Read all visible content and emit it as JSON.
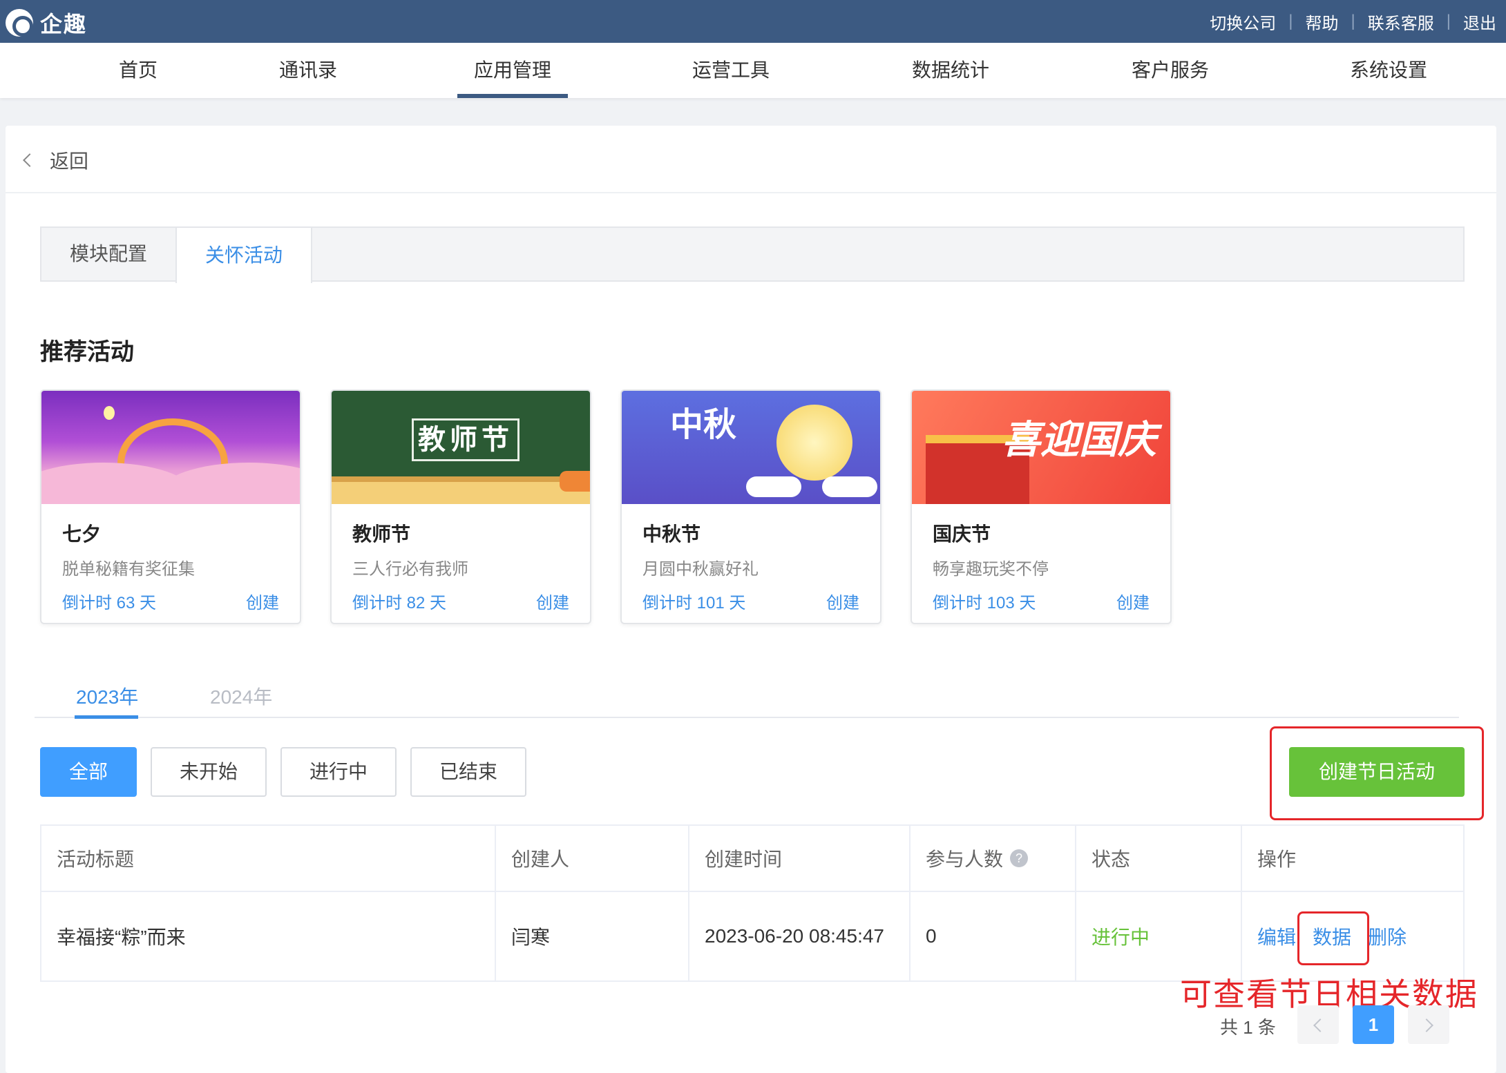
{
  "topbar": {
    "brand": "企趣",
    "links": [
      "切换公司",
      "帮助",
      "联系客服",
      "退出"
    ],
    "separator": "|"
  },
  "nav": {
    "items": [
      "首页",
      "通讯录",
      "应用管理",
      "运营工具",
      "数据统计",
      "客户服务",
      "系统设置"
    ],
    "active": "应用管理"
  },
  "back": {
    "label": "返回"
  },
  "tabs": [
    "模块配置",
    "关怀活动"
  ],
  "section_title": "推荐活动",
  "cards": [
    {
      "name": "七夕",
      "sub": "脱单秘籍有奖征集",
      "countdown": "倒计时 63 天",
      "action": "创建"
    },
    {
      "name": "教师节",
      "sub": "三人行必有我师",
      "countdown": "倒计时 82 天",
      "action": "创建",
      "banner_text": "教师节"
    },
    {
      "name": "中秋节",
      "sub": "月圆中秋赢好礼",
      "countdown": "倒计时 101 天",
      "action": "创建",
      "banner_text": "中秋"
    },
    {
      "name": "国庆节",
      "sub": "畅享趣玩奖不停",
      "countdown": "倒计时 103 天",
      "action": "创建",
      "banner_text": "喜迎国庆"
    }
  ],
  "years": [
    "2023年",
    "2024年"
  ],
  "filters": [
    "全部",
    "未开始",
    "进行中",
    "已结束"
  ],
  "create_button": "创建节日活动",
  "table": {
    "headers": [
      "活动标题",
      "创建人",
      "创建时间",
      "参与人数",
      "状态",
      "操作"
    ],
    "help_glyph": "?",
    "rows": [
      {
        "title": "幸福接“粽”而来",
        "creator": "闫寒",
        "created": "2023-06-20 08:45:47",
        "participants": "0",
        "status": "进行中",
        "ops": [
          "编辑",
          "数据",
          "删除"
        ]
      }
    ]
  },
  "annotation": "可查看节日相关数据",
  "pagination": {
    "total": "共 1 条",
    "current": "1"
  },
  "colors": {
    "topbar": "#3c5a82",
    "accent": "#409eff",
    "success": "#67c23a",
    "annotation": "#e5262a"
  }
}
